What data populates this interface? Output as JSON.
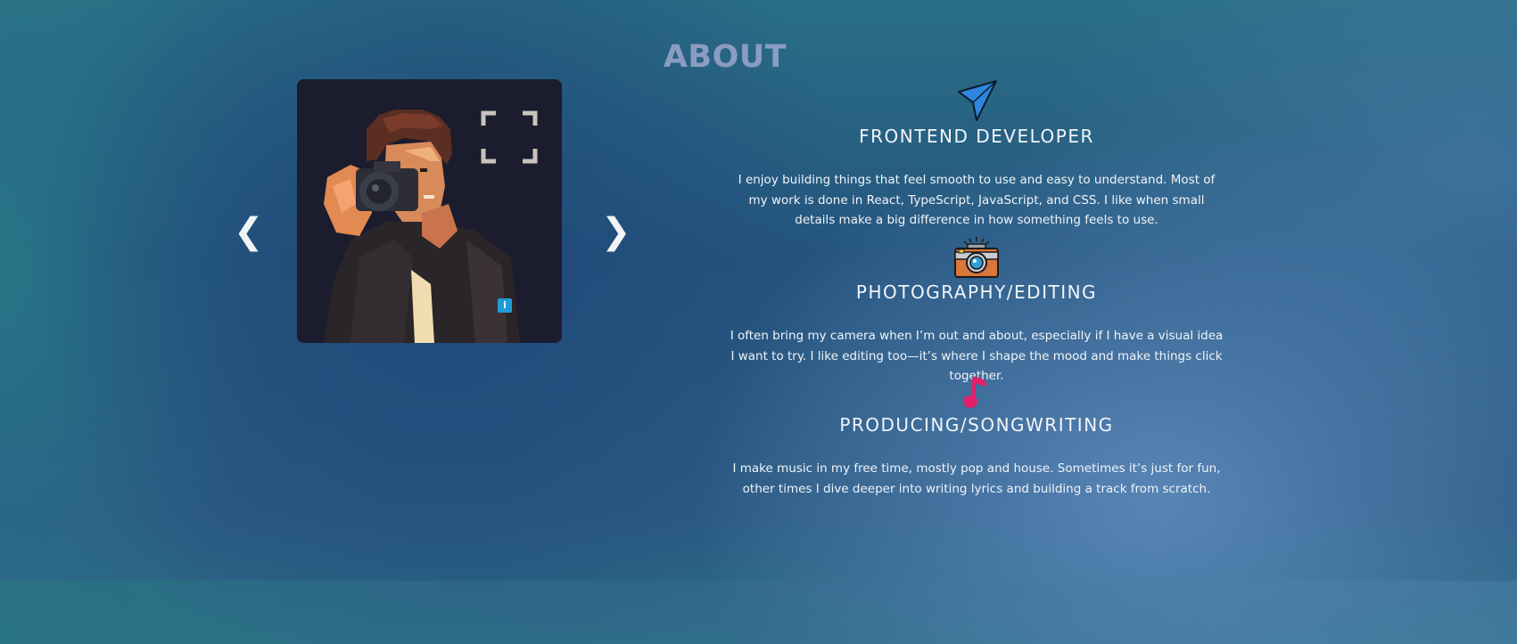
{
  "page": {
    "title": "ABOUT"
  },
  "gallery": {
    "prev_label": "❮",
    "next_label": "❯",
    "info_label": "i"
  },
  "sections": [
    {
      "icon": "paper-plane-icon",
      "heading": "FRONTEND DEVELOPER",
      "text": "I enjoy building things that feel smooth to use and easy to understand. Most of my work is done in React, TypeScript, JavaScript, and CSS. I like when small details make a big difference in how something feels to use."
    },
    {
      "icon": "camera-icon",
      "heading": "PHOTOGRAPHY/EDITING",
      "text": "I often bring my camera when I’m out and about, especially if I have a visual idea I want to try. I like editing too—it’s where I shape the mood and make things click together."
    },
    {
      "icon": "music-note-icon",
      "heading": "PRODUCING/SONGWRITING",
      "text": "I make music in my free time, mostly pop and house. Sometimes it’s just for fun, other times I dive deeper into writing lyrics and building a track from scratch."
    }
  ],
  "colors": {
    "title": "#8a9cc0",
    "accent_blue": "#2e86de",
    "accent_pink": "#e0206a",
    "text": "#f1f4f8"
  }
}
